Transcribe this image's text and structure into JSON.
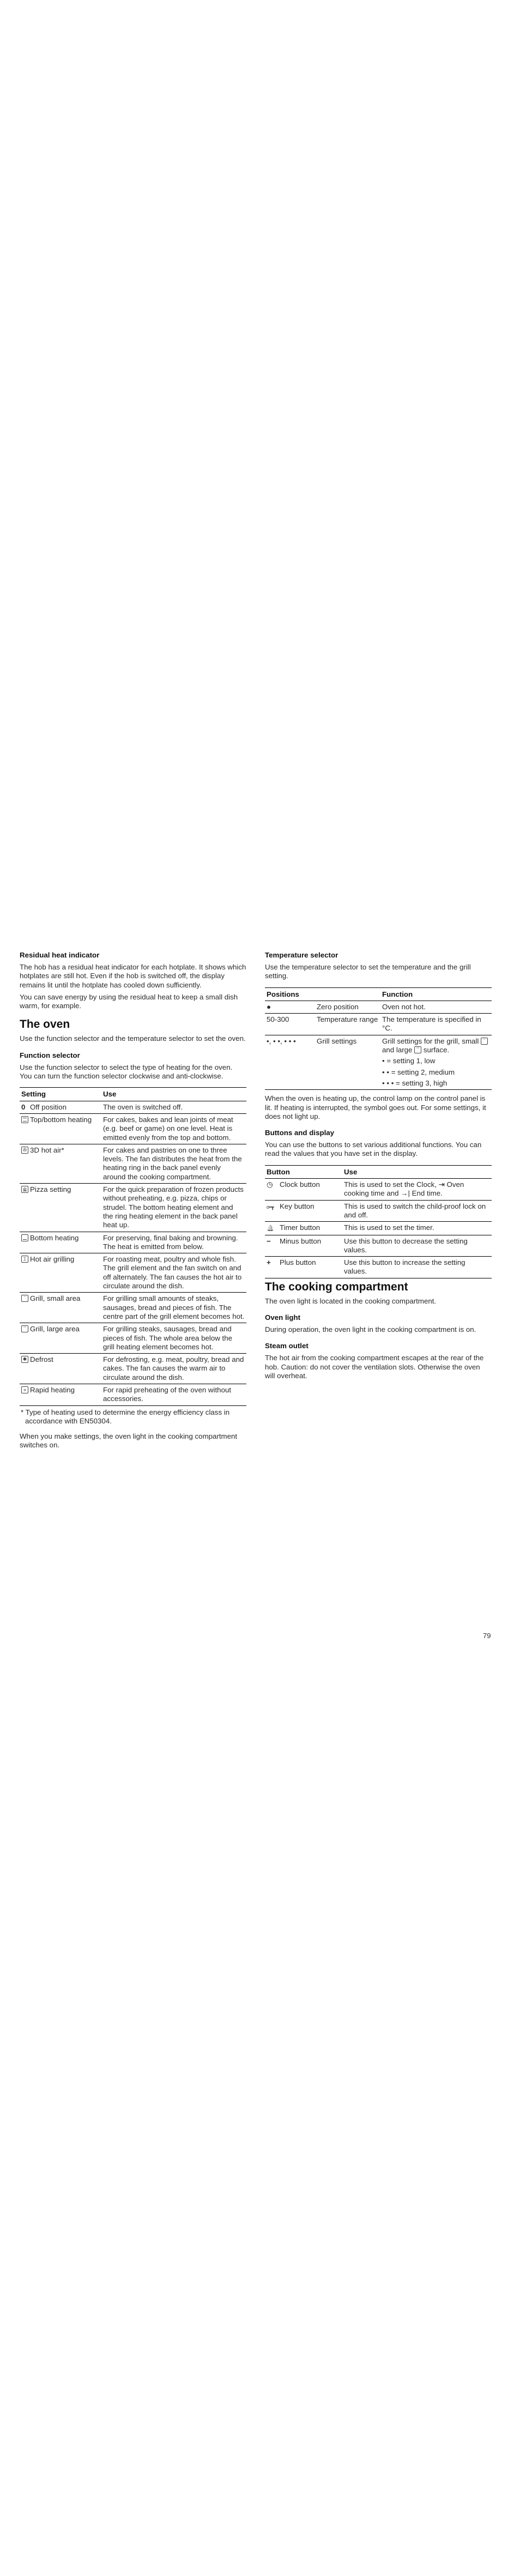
{
  "left": {
    "residual": {
      "heading": "Residual heat indicator",
      "p1": "The hob has a residual heat indicator for each hotplate. It shows which hotplates are still hot. Even if the hob is switched off, the display remains lit until the hotplate has cooled down sufficiently.",
      "p2": "You can save energy by using the residual heat to keep a small dish warm, for example."
    },
    "oven": {
      "heading": "The oven",
      "intro": "Use the function selector and the temperature selector to set the oven."
    },
    "function_selector": {
      "heading": "Function selector",
      "p1": "Use the function selector to select the type of heating for the oven.",
      "p2": "You can turn the function selector clockwise and anti-clockwise.",
      "table": {
        "col_setting": "Setting",
        "col_use": "Use",
        "rows": [
          {
            "icon": "0",
            "icon_name": "off-position-icon",
            "setting": "Off position",
            "use": "The oven is switched off."
          },
          {
            "icon": "",
            "icon_name": "top-bottom-heating-icon",
            "setting": "Top/bottom heating",
            "use": "For cakes, bakes and lean joints of meat (e.g. beef or game) on one level. Heat is emitted evenly from the top and bottom."
          },
          {
            "icon": "✇",
            "icon_name": "3d-hot-air-icon",
            "setting": "3D hot air*",
            "use": "For cakes and pastries on one to three levels. The fan distributes the heat from the heating ring in the back panel evenly around the cooking compartment."
          },
          {
            "icon": "⊛",
            "icon_name": "pizza-setting-icon",
            "setting": "Pizza setting",
            "use": "For the quick preparation of frozen products without preheating, e.g. pizza, chips or strudel. The bottom heating element and the ring heating element in the back panel heat up."
          },
          {
            "icon": "",
            "icon_name": "bottom-heating-icon",
            "setting": "Bottom heating",
            "use": "For preserving, final baking and browning. The heat is emitted from below."
          },
          {
            "icon": "ᛯ",
            "icon_name": "hot-air-grilling-icon",
            "setting": "Hot air grilling",
            "use": "For roasting meat, poultry and whole fish. The grill element and the fan switch on and off alternately. The fan causes the hot air to circulate around the dish."
          },
          {
            "icon": "ᵕ",
            "icon_name": "grill-small-area-icon",
            "setting": "Grill, small area",
            "use": "For grilling small amounts of steaks, sausages, bread and pieces of fish. The centre part of the grill element becomes hot."
          },
          {
            "icon": "ᵕᵕ",
            "icon_name": "grill-large-area-icon",
            "setting": "Grill, large area",
            "use": "For grilling steaks, sausages, bread and pieces of fish. The whole area below the grill heating element becomes hot."
          },
          {
            "icon": "✱",
            "icon_name": "defrost-icon",
            "setting": "Defrost",
            "use": "For defrosting, e.g. meat, poultry, bread and cakes. The fan causes the warm air to circulate around the dish."
          },
          {
            "icon": "»",
            "icon_name": "rapid-heating-icon",
            "setting": "Rapid heating",
            "use": "For rapid preheating of the oven without accessories."
          }
        ]
      },
      "footnote": "* Type of heating used to determine the energy efficiency class in accordance with EN50304.",
      "after": "When you make settings, the oven light in the cooking compartment switches on."
    }
  },
  "right": {
    "temperature": {
      "heading": "Temperature selector",
      "intro": "Use the temperature selector to set the temperature and the grill setting.",
      "table": {
        "col_positions": "Positions",
        "col_function": "Function",
        "rows": [
          {
            "pos": "●",
            "name": "Zero position",
            "function": "Oven not hot."
          },
          {
            "pos": "50-300",
            "name": "Temperature range",
            "function": "The temperature is specified in °C."
          },
          {
            "pos": "•, • •, • • •",
            "name": "Grill settings",
            "function": "Grill settings for the grill, small and large surface."
          }
        ],
        "grill_function_a": "Grill settings for the grill, small",
        "grill_function_b": "and large",
        "grill_function_c": "surface.",
        "grill_levels": [
          "• = setting 1, low",
          "• • = setting 2, medium",
          "• • • = setting 3, high"
        ]
      },
      "after": "When the oven is heating up, the control lamp on the control panel is lit. If heating is interrupted, the symbol goes out. For some settings, it does not light up."
    },
    "buttons": {
      "heading": "Buttons and display",
      "intro": "You can use the buttons to set various additional functions. You can read the values that you have set in the display.",
      "table": {
        "col_button": "Button",
        "col_use": "Use",
        "rows": [
          {
            "icon": "◷",
            "icon_name": "clock-icon",
            "button": "Clock button",
            "use": "This is used to set the Clock, ⇥ Oven cooking time and →| End time."
          },
          {
            "icon": "o━┳",
            "icon_name": "key-icon",
            "button": "Key button",
            "use": "This is used to switch the child-proof lock on and off."
          },
          {
            "icon": "🔔",
            "icon_name": "timer-bell-icon",
            "button": "Timer button",
            "use": "This is used to set the timer."
          },
          {
            "icon": "−",
            "icon_name": "minus-icon",
            "button": "Minus button",
            "use": "Use this button to decrease the setting values."
          },
          {
            "icon": "+",
            "icon_name": "plus-icon",
            "button": "Plus button",
            "use": "Use this button to increase the setting values."
          }
        ]
      }
    },
    "compartment": {
      "heading": "The cooking compartment",
      "intro": "The oven light is located in the cooking compartment.",
      "oven_light_heading": "Oven light",
      "oven_light_text": "During operation, the oven light in the cooking compartment is on.",
      "steam_heading": "Steam outlet",
      "steam_text": "The hot air from the cooking compartment escapes at the rear of the hob. Caution: do not cover the ventilation slots. Otherwise the oven will overheat."
    }
  },
  "page_number": "79"
}
